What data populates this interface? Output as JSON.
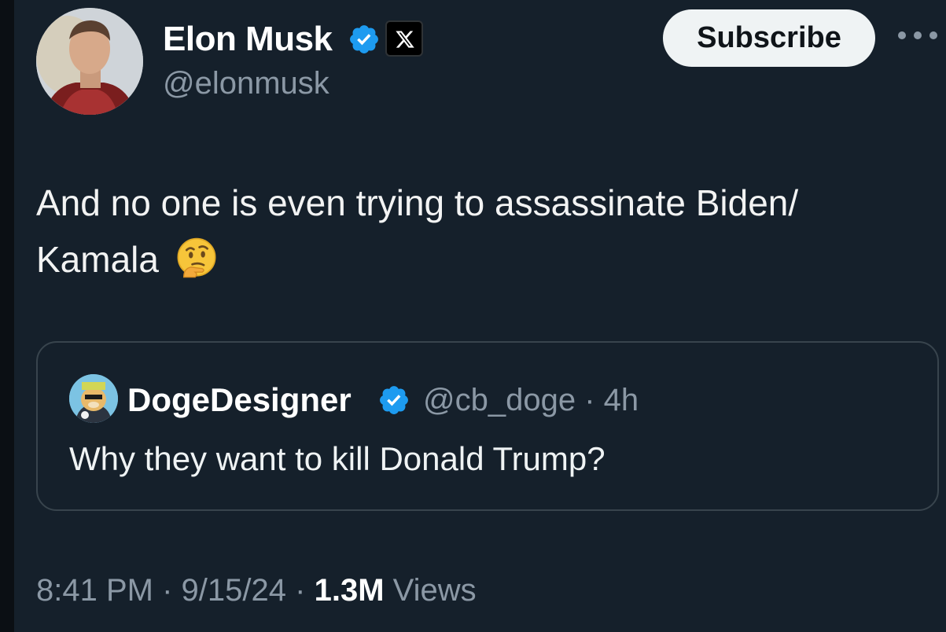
{
  "author": {
    "name": "Elon Musk",
    "handle": "@elonmusk",
    "avatar_icon": "profile-photo"
  },
  "header": {
    "subscribe_label": "Subscribe",
    "more_icon": "ellipsis-icon"
  },
  "tweet": {
    "text": "And no one is even trying to assassinate Biden/ Kamala",
    "emoji": "thinking-face"
  },
  "quote": {
    "name": "DogeDesigner",
    "handle": "@cb_doge",
    "separator": "·",
    "time": "4h",
    "text": "Why they want to kill Donald Trump?"
  },
  "meta": {
    "time": "8:41 PM",
    "date": "9/15/24",
    "separator": "·",
    "views_count": "1.3M",
    "views_label": "Views"
  },
  "colors": {
    "background": "#15202b",
    "verified_blue": "#1d9bf0",
    "secondary_text": "#8b98a5",
    "border": "#38444d"
  }
}
